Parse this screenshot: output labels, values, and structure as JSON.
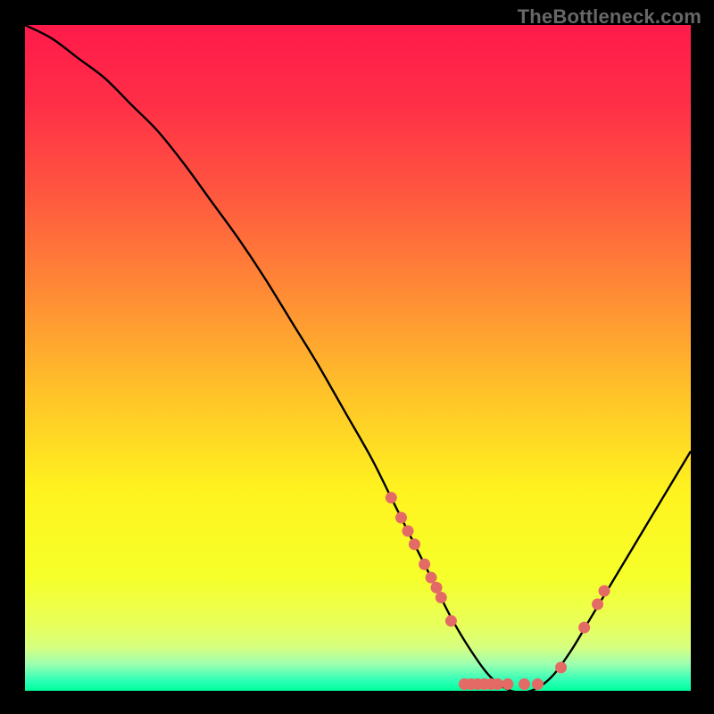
{
  "watermark": "TheBottleneck.com",
  "chart_data": {
    "type": "line",
    "title": "",
    "xlabel": "",
    "ylabel": "",
    "xlim": [
      0,
      100
    ],
    "ylim": [
      0,
      100
    ],
    "x": [
      0,
      4,
      8,
      12,
      16,
      20,
      24,
      28,
      32,
      36,
      40,
      44,
      48,
      52,
      55,
      58,
      61,
      64,
      67,
      70,
      73,
      76,
      79,
      82,
      85,
      88,
      91,
      94,
      97,
      100
    ],
    "values": [
      100,
      98,
      95,
      92,
      88,
      84,
      79,
      73.5,
      68,
      62,
      55.5,
      49,
      42,
      35,
      29,
      23,
      17,
      11,
      6,
      2,
      0,
      0,
      2,
      6,
      11,
      16,
      21,
      26,
      31,
      36
    ],
    "points": [
      {
        "x": 55.0,
        "y": 29.0
      },
      {
        "x": 56.5,
        "y": 26.0
      },
      {
        "x": 57.5,
        "y": 24.0
      },
      {
        "x": 58.5,
        "y": 22.0
      },
      {
        "x": 60.0,
        "y": 19.0
      },
      {
        "x": 61.0,
        "y": 17.0
      },
      {
        "x": 61.8,
        "y": 15.5
      },
      {
        "x": 62.5,
        "y": 14.0
      },
      {
        "x": 64.0,
        "y": 10.5
      },
      {
        "x": 66.0,
        "y": 1.0
      },
      {
        "x": 67.0,
        "y": 1.0
      },
      {
        "x": 68.0,
        "y": 1.0
      },
      {
        "x": 69.0,
        "y": 1.0
      },
      {
        "x": 70.0,
        "y": 1.0
      },
      {
        "x": 71.0,
        "y": 1.0
      },
      {
        "x": 72.5,
        "y": 1.0
      },
      {
        "x": 75.0,
        "y": 1.0
      },
      {
        "x": 77.0,
        "y": 1.0
      },
      {
        "x": 80.5,
        "y": 3.5
      },
      {
        "x": 84.0,
        "y": 9.5
      },
      {
        "x": 86.0,
        "y": 13.0
      },
      {
        "x": 87.0,
        "y": 15.0
      }
    ],
    "gradient_stops": [
      {
        "offset": 0.0,
        "color": "#ff1a4a"
      },
      {
        "offset": 0.12,
        "color": "#ff2f47"
      },
      {
        "offset": 0.25,
        "color": "#ff5640"
      },
      {
        "offset": 0.4,
        "color": "#ff8a35"
      },
      {
        "offset": 0.55,
        "color": "#ffc229"
      },
      {
        "offset": 0.7,
        "color": "#fff31f"
      },
      {
        "offset": 0.83,
        "color": "#f6ff2a"
      },
      {
        "offset": 0.9,
        "color": "#e8ff5a"
      },
      {
        "offset": 0.935,
        "color": "#d6ff80"
      },
      {
        "offset": 0.96,
        "color": "#9cffb0"
      },
      {
        "offset": 0.985,
        "color": "#2dffb7"
      },
      {
        "offset": 1.0,
        "color": "#00ff9a"
      }
    ],
    "point_color": "#e46a66",
    "curve_color": "#000000"
  }
}
